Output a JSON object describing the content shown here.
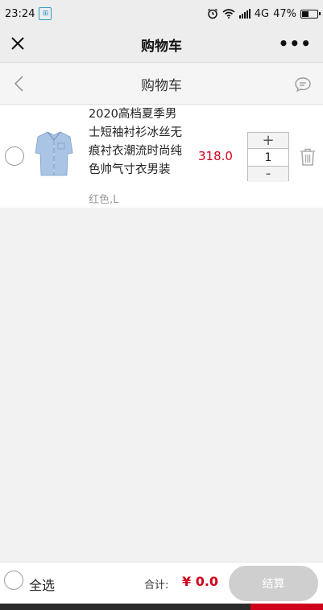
{
  "status_bar": {
    "time": "23:24",
    "network": "4G",
    "battery": "47%",
    "battery_level": 0.47
  },
  "wechat_header": {
    "title": "购物车",
    "more_label": "•••"
  },
  "page_header": {
    "title": "购物车"
  },
  "cart": {
    "items": [
      {
        "title": "2020高档夏季男士短袖衬衫冰丝无痕衬衣潮流时尚纯色帅气寸衣男装",
        "spec": "红色,L",
        "price": "318.0",
        "quantity": "1",
        "plus_label": "+",
        "minus_label": "-"
      }
    ]
  },
  "footer": {
    "select_all_label": "全选",
    "total_label": "合计:",
    "total_value": "¥ 0.0",
    "checkout_label": "结算"
  },
  "colors": {
    "price": "#d0021b",
    "checkout_disabled": "#cfcfcf",
    "background": "#f2f2f2"
  }
}
